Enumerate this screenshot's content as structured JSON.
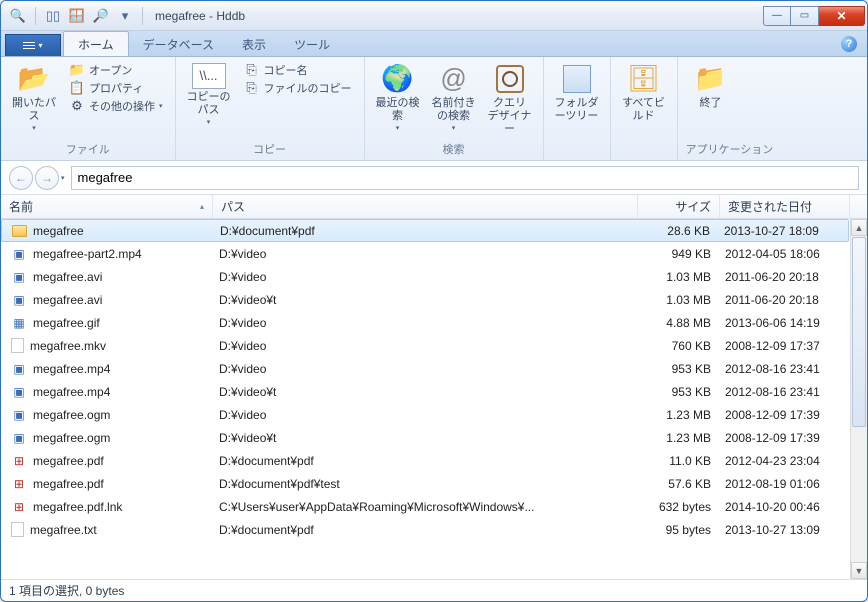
{
  "title": "megafree - Hddb",
  "tabs": {
    "file": "",
    "home": "ホーム",
    "database": "データベース",
    "view": "表示",
    "tool": "ツール"
  },
  "ribbon": {
    "file": {
      "label": "ファイル",
      "open_path": "開いたパス",
      "open": "オープン",
      "property": "プロパティ",
      "other_ops": "その他の操作"
    },
    "copy": {
      "label": "コピー",
      "copy_path": "コピーのパス",
      "copy_name": "コピー名",
      "file_copy": "ファイルのコピー"
    },
    "search": {
      "label": "検索",
      "recent": "最近の検索",
      "named": "名前付きの検索",
      "query_designer": "クエリ デザイナー"
    },
    "folder_tree": "フォルダーツリー",
    "build_all": "すべてビルド",
    "app": {
      "label": "アプリケーション",
      "exit": "終了"
    }
  },
  "nav": {
    "query": "megafree"
  },
  "columns": {
    "name": "名前",
    "path": "パス",
    "size": "サイズ",
    "date": "変更された日付"
  },
  "rows": [
    {
      "icon": "folder",
      "name": "megafree",
      "path": "D:¥document¥pdf",
      "size": "28.6 KB",
      "date": "2013-10-27 18:09",
      "selected": true
    },
    {
      "icon": "video",
      "name": "megafree-part2.mp4",
      "path": "D:¥video",
      "size": "949 KB",
      "date": "2012-04-05 18:06"
    },
    {
      "icon": "video",
      "name": "megafree.avi",
      "path": "D:¥video",
      "size": "1.03 MB",
      "date": "2011-06-20 20:18"
    },
    {
      "icon": "video",
      "name": "megafree.avi",
      "path": "D:¥video¥t",
      "size": "1.03 MB",
      "date": "2011-06-20 20:18"
    },
    {
      "icon": "img",
      "name": "megafree.gif",
      "path": "D:¥video",
      "size": "4.88 MB",
      "date": "2013-06-06 14:19"
    },
    {
      "icon": "blank",
      "name": "megafree.mkv",
      "path": "D:¥video",
      "size": "760 KB",
      "date": "2008-12-09 17:37"
    },
    {
      "icon": "video",
      "name": "megafree.mp4",
      "path": "D:¥video",
      "size": "953 KB",
      "date": "2012-08-16 23:41"
    },
    {
      "icon": "video",
      "name": "megafree.mp4",
      "path": "D:¥video¥t",
      "size": "953 KB",
      "date": "2012-08-16 23:41"
    },
    {
      "icon": "video",
      "name": "megafree.ogm",
      "path": "D:¥video",
      "size": "1.23 MB",
      "date": "2008-12-09 17:39"
    },
    {
      "icon": "video",
      "name": "megafree.ogm",
      "path": "D:¥video¥t",
      "size": "1.23 MB",
      "date": "2008-12-09 17:39"
    },
    {
      "icon": "pdf",
      "name": "megafree.pdf",
      "path": "D:¥document¥pdf",
      "size": "11.0 KB",
      "date": "2012-04-23 23:04"
    },
    {
      "icon": "pdf",
      "name": "megafree.pdf",
      "path": "D:¥document¥pdf¥test",
      "size": "57.6 KB",
      "date": "2012-08-19 01:06"
    },
    {
      "icon": "pdf",
      "name": "megafree.pdf.lnk",
      "path": "C:¥Users¥user¥AppData¥Roaming¥Microsoft¥Windows¥...",
      "size": "632 bytes",
      "date": "2014-10-20 00:46"
    },
    {
      "icon": "blank",
      "name": "megafree.txt",
      "path": "D:¥document¥pdf",
      "size": "95 bytes",
      "date": "2013-10-27 13:09"
    }
  ],
  "status": "1 項目の選択,  0 bytes"
}
